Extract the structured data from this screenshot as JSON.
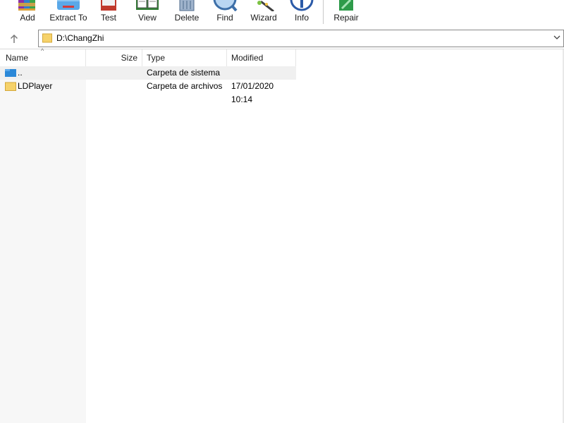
{
  "toolbar": {
    "buttons": [
      {
        "id": "add",
        "label": "Add",
        "icon": "archive-books-icon"
      },
      {
        "id": "extract",
        "label": "Extract To",
        "icon": "extract-folder-icon"
      },
      {
        "id": "test",
        "label": "Test",
        "icon": "test-check-icon"
      },
      {
        "id": "view",
        "label": "View",
        "icon": "open-book-icon"
      },
      {
        "id": "delete",
        "label": "Delete",
        "icon": "trash-icon"
      },
      {
        "id": "find",
        "label": "Find",
        "icon": "magnifier-icon"
      },
      {
        "id": "wizard",
        "label": "Wizard",
        "icon": "magic-wand-icon"
      },
      {
        "id": "info",
        "label": "Info",
        "icon": "info-icon"
      },
      {
        "id": "repair",
        "label": "Repair",
        "icon": "first-aid-icon"
      }
    ]
  },
  "address": {
    "path": "D:\\ChangZhi",
    "up_icon": "up-arrow-icon"
  },
  "list": {
    "columns": {
      "name": "Name",
      "size": "Size",
      "type": "Type",
      "modified": "Modified"
    },
    "sort_indicator": "^",
    "rows": [
      {
        "name": "..",
        "size": "",
        "type": "Carpeta de sistema",
        "modified": "",
        "icon": "parent-folder-icon"
      },
      {
        "name": "LDPlayer",
        "size": "",
        "type": "Carpeta de archivos",
        "modified": "17/01/2020 10:14",
        "icon": "folder-icon"
      }
    ]
  },
  "colors": {
    "folder_yellow": "#f6d26a",
    "parent_blue": "#2b88d8",
    "selected_row": "#f0f0f0"
  }
}
